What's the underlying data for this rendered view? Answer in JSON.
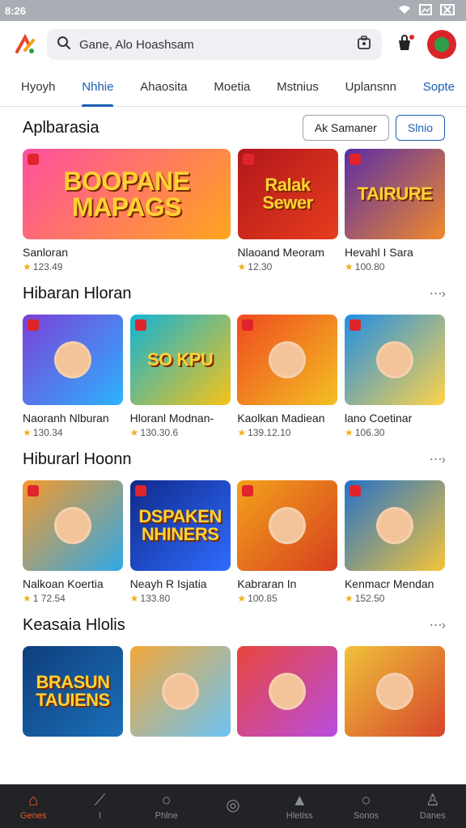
{
  "status": {
    "time": "8:26",
    "icons": [
      "wifi-icon",
      "image-icon",
      "close-box-icon"
    ]
  },
  "search": {
    "value": "Gane, Alo Hoashsam",
    "placeholder": ""
  },
  "tabs": [
    {
      "label": "Hyoyh",
      "active": false
    },
    {
      "label": "Nhhie",
      "active": true
    },
    {
      "label": "Ahaosita",
      "active": false
    },
    {
      "label": "Moetia",
      "active": false
    },
    {
      "label": "Mstnius",
      "active": false
    },
    {
      "label": "Uplansnn",
      "active": false
    },
    {
      "label": "Sopte",
      "active": false
    }
  ],
  "sections": [
    {
      "title": "Aplbarasia",
      "buttons": [
        "Ak Samaner",
        "Slnio"
      ],
      "cards": [
        {
          "name": "Sanloran",
          "rating": "123.49",
          "art": "BOOPANE MAPAGS",
          "colors": [
            "#ff4fa0",
            "#ffa51e"
          ],
          "wide": true
        },
        {
          "name": "Nlaoand Meoram",
          "rating": "12.30",
          "art": "Ralak Sewer",
          "colors": [
            "#b3171c",
            "#e63d1d"
          ],
          "wide": false
        },
        {
          "name": "Hevahl I Sara",
          "rating": "100.80",
          "art": "TAIRURE",
          "colors": [
            "#5a2ea6",
            "#f08a2b"
          ],
          "wide": false
        }
      ]
    },
    {
      "title": "Hibaran Hloran",
      "cards": [
        {
          "name": "Naoranh Nlburan",
          "rating": "130.34",
          "art": "",
          "colors": [
            "#7b3fd6",
            "#2db3ff"
          ]
        },
        {
          "name": "Hloranl Modnan-",
          "rating": "130.30.6",
          "art": "SO KPU",
          "colors": [
            "#12b3d6",
            "#f6c318"
          ]
        },
        {
          "name": "Kaolkan Madiean",
          "rating": "139.12.10",
          "art": "",
          "colors": [
            "#f04a1f",
            "#f2c023"
          ]
        },
        {
          "name": "lano Coetinar",
          "rating": "106.30",
          "art": "",
          "colors": [
            "#1f8ee6",
            "#ffd34a"
          ]
        }
      ]
    },
    {
      "title": "Hiburarl Hoonn",
      "cards": [
        {
          "name": "Nalkoan Koertia",
          "rating": "1 72.54",
          "art": "",
          "colors": [
            "#f59a2b",
            "#2fa8e8"
          ]
        },
        {
          "name": "Neayh R Isjatia",
          "rating": "133.80",
          "art": "DSPAKEN NHINERS",
          "colors": [
            "#10298a",
            "#2f6cff"
          ]
        },
        {
          "name": "Kabraran In",
          "rating": "100.85",
          "art": "",
          "colors": [
            "#f3a21c",
            "#d6401e"
          ]
        },
        {
          "name": "Kenmacr Mendan",
          "rating": "152.50",
          "art": "",
          "colors": [
            "#2472c9",
            "#f5c43a"
          ]
        }
      ]
    },
    {
      "title": "Keasaia Hlolis",
      "cards": [
        {
          "name": "",
          "rating": "",
          "art": "BRASUN TAUIENS",
          "colors": [
            "#0f3f7d",
            "#1a6fb8"
          ]
        },
        {
          "name": "",
          "rating": "",
          "art": "",
          "colors": [
            "#f2a83a",
            "#6bc3f4"
          ]
        },
        {
          "name": "",
          "rating": "",
          "art": "",
          "colors": [
            "#e8463d",
            "#b84de0"
          ]
        },
        {
          "name": "",
          "rating": "",
          "art": "",
          "colors": [
            "#f0c23a",
            "#d6452b"
          ]
        }
      ]
    }
  ],
  "bottom_nav": [
    {
      "label": "Genes",
      "icon": "home-icon",
      "glyph": "⌂",
      "active": true
    },
    {
      "label": "I",
      "icon": "wand-icon",
      "glyph": "⟋",
      "active": false
    },
    {
      "label": "Phlne",
      "icon": "search-icon",
      "glyph": "○",
      "active": false
    },
    {
      "label": "",
      "icon": "record-icon",
      "glyph": "◎",
      "active": false
    },
    {
      "label": "Hletiss",
      "icon": "bell-icon",
      "glyph": "▲",
      "active": false
    },
    {
      "label": "Sonos",
      "icon": "search-icon",
      "glyph": "○",
      "active": false
    },
    {
      "label": "Danes",
      "icon": "person-icon",
      "glyph": "♙",
      "active": false
    }
  ],
  "accent": "#1a5fb4",
  "nav_active_color": "#e8581d"
}
